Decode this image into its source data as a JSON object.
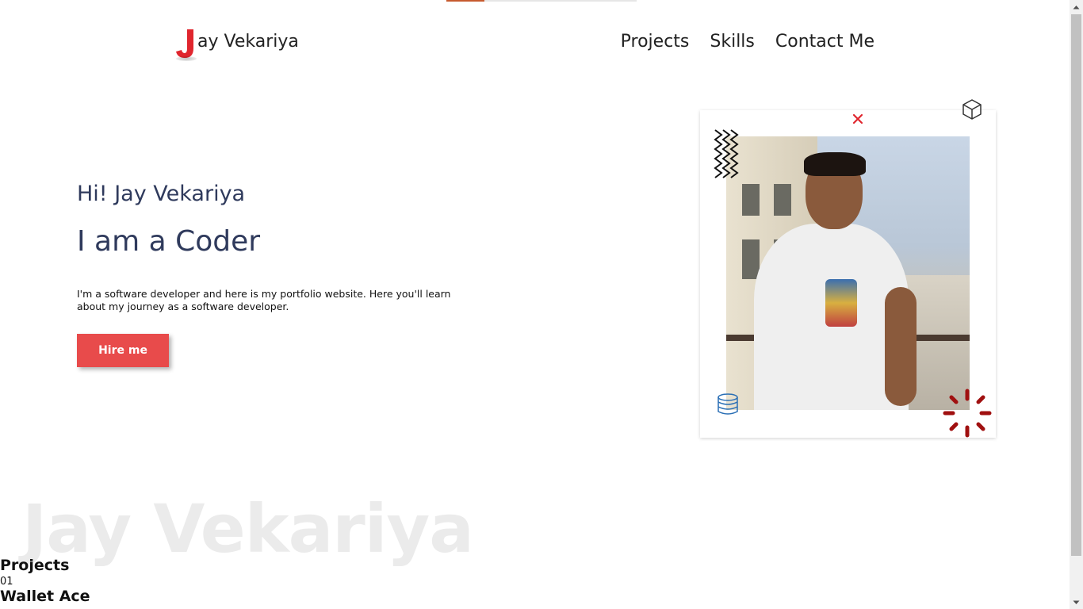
{
  "progress": {
    "fraction": 0.2
  },
  "header": {
    "logo_text": "ay Vekariya",
    "logo_letter": "J",
    "nav": [
      {
        "label": "Projects"
      },
      {
        "label": "Skills"
      },
      {
        "label": "Contact Me"
      }
    ]
  },
  "hero": {
    "greeting": "Hi! Jay Vekariya",
    "title": "I am a Coder",
    "description": "I'm a software developer and here is my portfolio website. Here you'll learn about my journey as a software developer.",
    "hire_label": "Hire me"
  },
  "photo_card": {
    "icons": [
      "cube-icon",
      "close-icon",
      "zigzag-icon",
      "database-icon",
      "spinner-icon"
    ]
  },
  "projects": {
    "watermark": "Jay Vekariya",
    "section_title": "Projects",
    "number": "01",
    "first_project": "Wallet Ace"
  },
  "colors": {
    "accent": "#e84b4b",
    "heading": "#2f3a5c",
    "progress": "#c65a2e",
    "spinner": "#a01010"
  }
}
